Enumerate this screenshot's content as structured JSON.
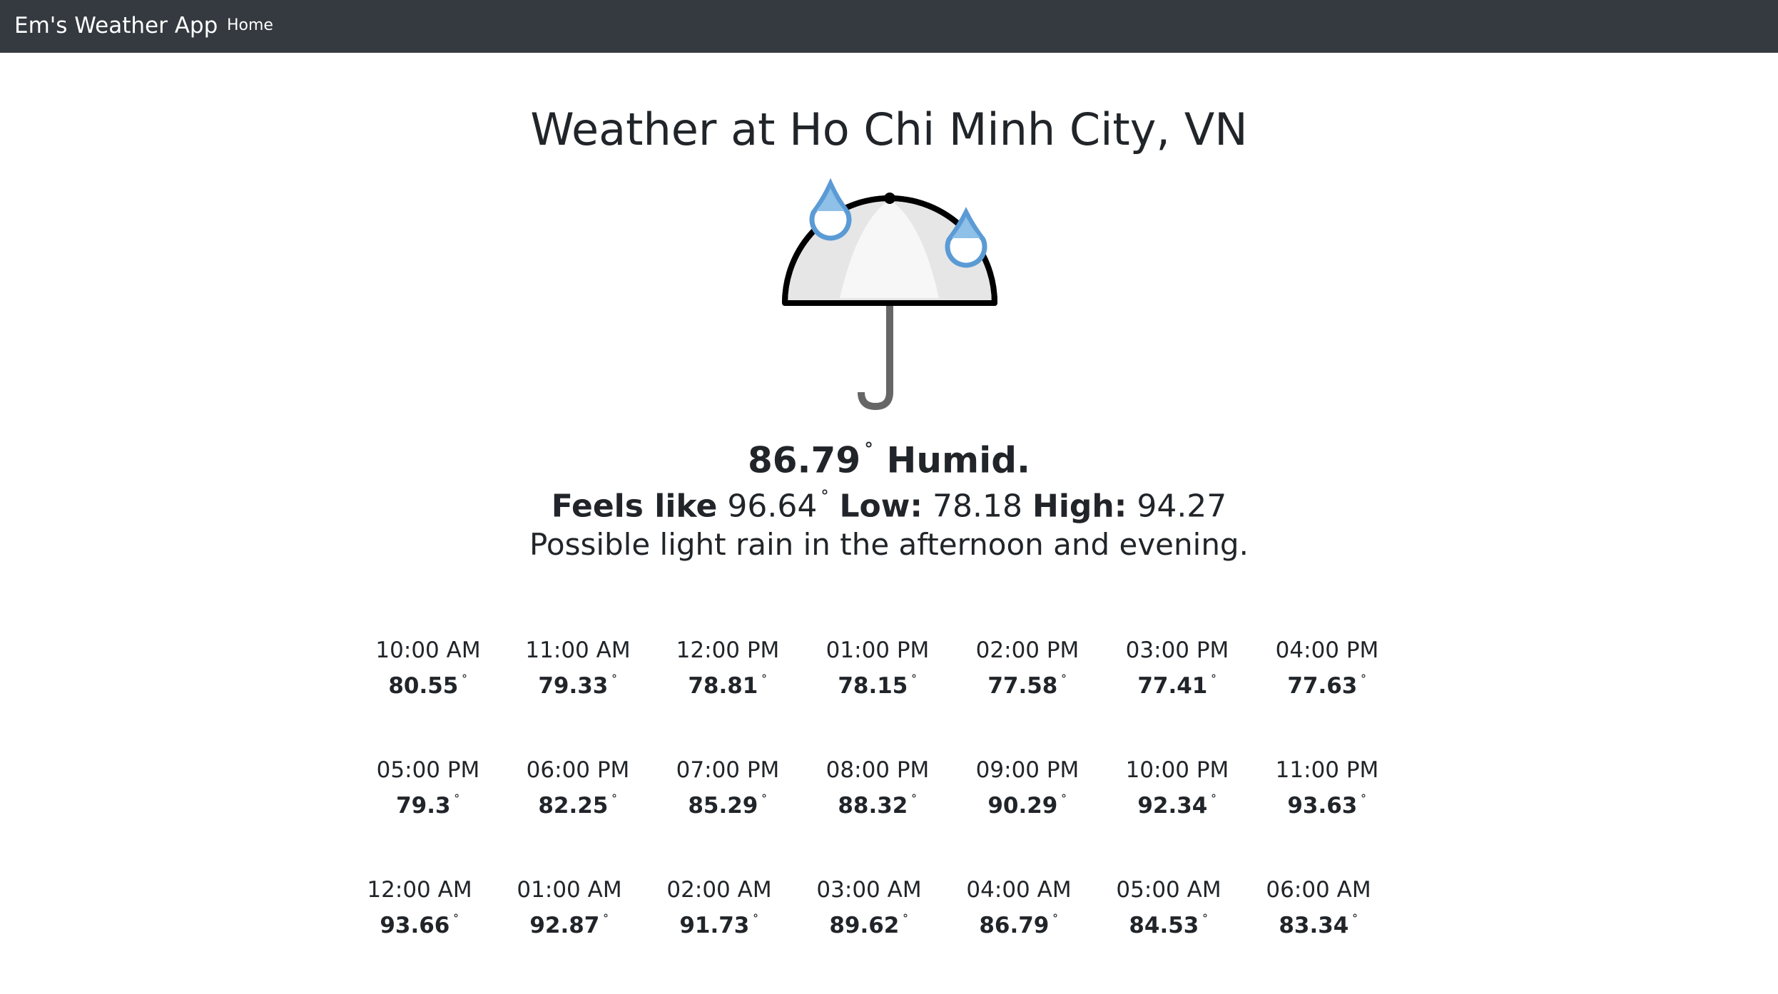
{
  "navbar": {
    "brand": "Em's Weather App",
    "home_link": "Home"
  },
  "location_title": "Weather at Ho Chi Minh City, VN",
  "icon": "umbrella-rain-icon",
  "current": {
    "temperature": "86.79",
    "degree_symbol": "˚",
    "condition": "Humid.",
    "feels_like_label": "Feels like",
    "feels_like": "96.64",
    "low_label": "Low:",
    "low": "78.18",
    "high_label": "High:",
    "high": "94.27",
    "summary": "Possible light rain in the afternoon and evening."
  },
  "hourly": [
    {
      "time": "10:00 AM",
      "temp": "80.55"
    },
    {
      "time": "11:00 AM",
      "temp": "79.33"
    },
    {
      "time": "12:00 PM",
      "temp": "78.81"
    },
    {
      "time": "01:00 PM",
      "temp": "78.15"
    },
    {
      "time": "02:00 PM",
      "temp": "77.58"
    },
    {
      "time": "03:00 PM",
      "temp": "77.41"
    },
    {
      "time": "04:00 PM",
      "temp": "77.63"
    },
    {
      "time": "05:00 PM",
      "temp": "79.3"
    },
    {
      "time": "06:00 PM",
      "temp": "82.25"
    },
    {
      "time": "07:00 PM",
      "temp": "85.29"
    },
    {
      "time": "08:00 PM",
      "temp": "88.32"
    },
    {
      "time": "09:00 PM",
      "temp": "90.29"
    },
    {
      "time": "10:00 PM",
      "temp": "92.34"
    },
    {
      "time": "11:00 PM",
      "temp": "93.63"
    },
    {
      "time": "12:00 AM",
      "temp": "93.66"
    },
    {
      "time": "01:00 AM",
      "temp": "92.87"
    },
    {
      "time": "02:00 AM",
      "temp": "91.73"
    },
    {
      "time": "03:00 AM",
      "temp": "89.62"
    },
    {
      "time": "04:00 AM",
      "temp": "86.79"
    },
    {
      "time": "05:00 AM",
      "temp": "84.53"
    },
    {
      "time": "06:00 AM",
      "temp": "83.34"
    }
  ],
  "colors": {
    "navbar_bg": "#343a40",
    "text": "#212529",
    "raindrop": "#5b9bd5"
  }
}
